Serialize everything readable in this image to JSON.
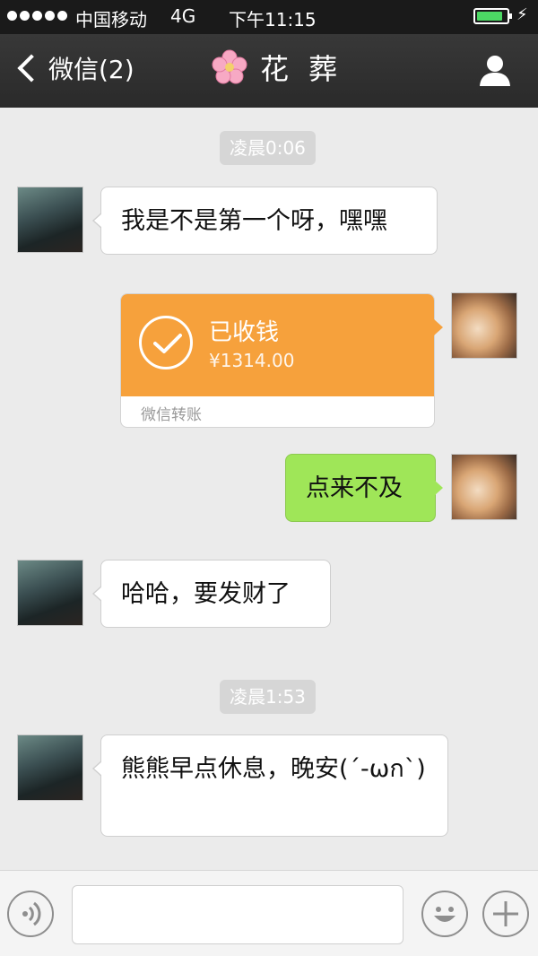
{
  "status_bar": {
    "carrier": "中国移动",
    "network": "4G",
    "time": "下午11:15",
    "signal_dots": 5,
    "battery_level": 0.9,
    "battery_color": "#4cd964",
    "charging_icon": "lightning-icon"
  },
  "nav": {
    "back_label": "微信(2)",
    "title": "花 葬",
    "title_icon": "cherry-blossom-icon",
    "profile_icon": "person-icon"
  },
  "messages": [
    {
      "type": "timestamp",
      "text": "凌晨0:06"
    },
    {
      "type": "text",
      "side": "left",
      "text": "我是不是第一个呀，嘿嘿"
    },
    {
      "type": "transfer",
      "side": "right",
      "status": "已收钱",
      "amount": "¥1314.00",
      "footer": "微信转账",
      "accent": "#f6a13c"
    },
    {
      "type": "text",
      "side": "right",
      "text": "点来不及",
      "bubble_color": "#9fe658"
    },
    {
      "type": "text",
      "side": "left",
      "text": "哈哈，要发财了"
    },
    {
      "type": "timestamp",
      "text": "凌晨1:53"
    },
    {
      "type": "text",
      "side": "left",
      "text": "熊熊早点休息，晚安(´-ωก`)"
    }
  ],
  "input_bar": {
    "voice_icon": "voice-icon",
    "emoji_icon": "emoji-icon",
    "plus_icon": "plus-icon",
    "message_value": ""
  }
}
